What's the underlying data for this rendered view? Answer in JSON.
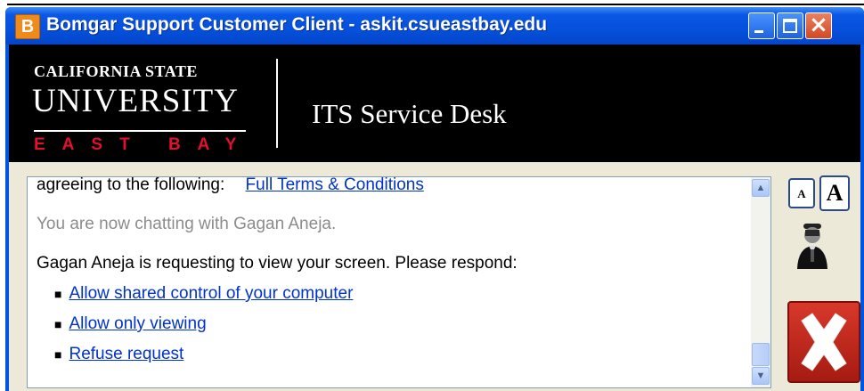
{
  "window": {
    "app_icon_letter": "B",
    "title": "Bomgar Support Customer Client - askit.csueastbay.edu"
  },
  "banner": {
    "logo_line1": "CALIFORNIA STATE",
    "logo_line2": "UNIVERSITY",
    "logo_line3": "EAST BAY",
    "desk_title": "ITS Service Desk"
  },
  "chat": {
    "agreeing_text": "agreeing to the following:",
    "terms_link": "Full Terms & Conditions",
    "status_text": "You are now chatting with Gagan Aneja.",
    "request_text": "Gagan Aneja is requesting to view your screen.  Please respond:",
    "options": [
      {
        "label": "Allow shared control of your computer"
      },
      {
        "label": "Allow only viewing"
      },
      {
        "label": "Refuse request"
      }
    ]
  },
  "controls": {
    "font_small_label": "A",
    "font_large_label": "A"
  },
  "colors": {
    "titlebar": "#0054e3",
    "link": "#0033cc",
    "logo_red": "#e3102b",
    "close_red": "#c22a1f"
  }
}
